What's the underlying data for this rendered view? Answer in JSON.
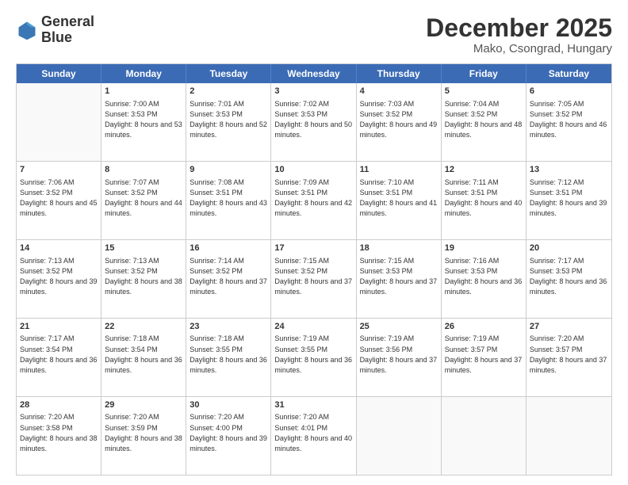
{
  "logo": {
    "line1": "General",
    "line2": "Blue"
  },
  "title": "December 2025",
  "subtitle": "Mako, Csongrad, Hungary",
  "days": [
    "Sunday",
    "Monday",
    "Tuesday",
    "Wednesday",
    "Thursday",
    "Friday",
    "Saturday"
  ],
  "weeks": [
    [
      {
        "day": "",
        "sunrise": "",
        "sunset": "",
        "daylight": ""
      },
      {
        "day": "1",
        "sunrise": "Sunrise: 7:00 AM",
        "sunset": "Sunset: 3:53 PM",
        "daylight": "Daylight: 8 hours and 53 minutes."
      },
      {
        "day": "2",
        "sunrise": "Sunrise: 7:01 AM",
        "sunset": "Sunset: 3:53 PM",
        "daylight": "Daylight: 8 hours and 52 minutes."
      },
      {
        "day": "3",
        "sunrise": "Sunrise: 7:02 AM",
        "sunset": "Sunset: 3:53 PM",
        "daylight": "Daylight: 8 hours and 50 minutes."
      },
      {
        "day": "4",
        "sunrise": "Sunrise: 7:03 AM",
        "sunset": "Sunset: 3:52 PM",
        "daylight": "Daylight: 8 hours and 49 minutes."
      },
      {
        "day": "5",
        "sunrise": "Sunrise: 7:04 AM",
        "sunset": "Sunset: 3:52 PM",
        "daylight": "Daylight: 8 hours and 48 minutes."
      },
      {
        "day": "6",
        "sunrise": "Sunrise: 7:05 AM",
        "sunset": "Sunset: 3:52 PM",
        "daylight": "Daylight: 8 hours and 46 minutes."
      }
    ],
    [
      {
        "day": "7",
        "sunrise": "Sunrise: 7:06 AM",
        "sunset": "Sunset: 3:52 PM",
        "daylight": "Daylight: 8 hours and 45 minutes."
      },
      {
        "day": "8",
        "sunrise": "Sunrise: 7:07 AM",
        "sunset": "Sunset: 3:52 PM",
        "daylight": "Daylight: 8 hours and 44 minutes."
      },
      {
        "day": "9",
        "sunrise": "Sunrise: 7:08 AM",
        "sunset": "Sunset: 3:51 PM",
        "daylight": "Daylight: 8 hours and 43 minutes."
      },
      {
        "day": "10",
        "sunrise": "Sunrise: 7:09 AM",
        "sunset": "Sunset: 3:51 PM",
        "daylight": "Daylight: 8 hours and 42 minutes."
      },
      {
        "day": "11",
        "sunrise": "Sunrise: 7:10 AM",
        "sunset": "Sunset: 3:51 PM",
        "daylight": "Daylight: 8 hours and 41 minutes."
      },
      {
        "day": "12",
        "sunrise": "Sunrise: 7:11 AM",
        "sunset": "Sunset: 3:51 PM",
        "daylight": "Daylight: 8 hours and 40 minutes."
      },
      {
        "day": "13",
        "sunrise": "Sunrise: 7:12 AM",
        "sunset": "Sunset: 3:51 PM",
        "daylight": "Daylight: 8 hours and 39 minutes."
      }
    ],
    [
      {
        "day": "14",
        "sunrise": "Sunrise: 7:13 AM",
        "sunset": "Sunset: 3:52 PM",
        "daylight": "Daylight: 8 hours and 39 minutes."
      },
      {
        "day": "15",
        "sunrise": "Sunrise: 7:13 AM",
        "sunset": "Sunset: 3:52 PM",
        "daylight": "Daylight: 8 hours and 38 minutes."
      },
      {
        "day": "16",
        "sunrise": "Sunrise: 7:14 AM",
        "sunset": "Sunset: 3:52 PM",
        "daylight": "Daylight: 8 hours and 37 minutes."
      },
      {
        "day": "17",
        "sunrise": "Sunrise: 7:15 AM",
        "sunset": "Sunset: 3:52 PM",
        "daylight": "Daylight: 8 hours and 37 minutes."
      },
      {
        "day": "18",
        "sunrise": "Sunrise: 7:15 AM",
        "sunset": "Sunset: 3:53 PM",
        "daylight": "Daylight: 8 hours and 37 minutes."
      },
      {
        "day": "19",
        "sunrise": "Sunrise: 7:16 AM",
        "sunset": "Sunset: 3:53 PM",
        "daylight": "Daylight: 8 hours and 36 minutes."
      },
      {
        "day": "20",
        "sunrise": "Sunrise: 7:17 AM",
        "sunset": "Sunset: 3:53 PM",
        "daylight": "Daylight: 8 hours and 36 minutes."
      }
    ],
    [
      {
        "day": "21",
        "sunrise": "Sunrise: 7:17 AM",
        "sunset": "Sunset: 3:54 PM",
        "daylight": "Daylight: 8 hours and 36 minutes."
      },
      {
        "day": "22",
        "sunrise": "Sunrise: 7:18 AM",
        "sunset": "Sunset: 3:54 PM",
        "daylight": "Daylight: 8 hours and 36 minutes."
      },
      {
        "day": "23",
        "sunrise": "Sunrise: 7:18 AM",
        "sunset": "Sunset: 3:55 PM",
        "daylight": "Daylight: 8 hours and 36 minutes."
      },
      {
        "day": "24",
        "sunrise": "Sunrise: 7:19 AM",
        "sunset": "Sunset: 3:55 PM",
        "daylight": "Daylight: 8 hours and 36 minutes."
      },
      {
        "day": "25",
        "sunrise": "Sunrise: 7:19 AM",
        "sunset": "Sunset: 3:56 PM",
        "daylight": "Daylight: 8 hours and 37 minutes."
      },
      {
        "day": "26",
        "sunrise": "Sunrise: 7:19 AM",
        "sunset": "Sunset: 3:57 PM",
        "daylight": "Daylight: 8 hours and 37 minutes."
      },
      {
        "day": "27",
        "sunrise": "Sunrise: 7:20 AM",
        "sunset": "Sunset: 3:57 PM",
        "daylight": "Daylight: 8 hours and 37 minutes."
      }
    ],
    [
      {
        "day": "28",
        "sunrise": "Sunrise: 7:20 AM",
        "sunset": "Sunset: 3:58 PM",
        "daylight": "Daylight: 8 hours and 38 minutes."
      },
      {
        "day": "29",
        "sunrise": "Sunrise: 7:20 AM",
        "sunset": "Sunset: 3:59 PM",
        "daylight": "Daylight: 8 hours and 38 minutes."
      },
      {
        "day": "30",
        "sunrise": "Sunrise: 7:20 AM",
        "sunset": "Sunset: 4:00 PM",
        "daylight": "Daylight: 8 hours and 39 minutes."
      },
      {
        "day": "31",
        "sunrise": "Sunrise: 7:20 AM",
        "sunset": "Sunset: 4:01 PM",
        "daylight": "Daylight: 8 hours and 40 minutes."
      },
      {
        "day": "",
        "sunrise": "",
        "sunset": "",
        "daylight": ""
      },
      {
        "day": "",
        "sunrise": "",
        "sunset": "",
        "daylight": ""
      },
      {
        "day": "",
        "sunrise": "",
        "sunset": "",
        "daylight": ""
      }
    ]
  ]
}
